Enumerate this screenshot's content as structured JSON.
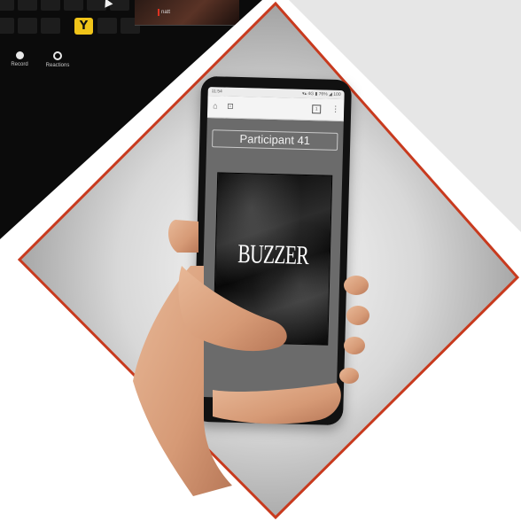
{
  "meeting": {
    "key_label": "Y",
    "video_caption": "natt",
    "tools": {
      "record": "Record",
      "reactions": "Reactions"
    }
  },
  "phone": {
    "status_time": "11:54",
    "status_right": "▾▴ 4G ▮ 76% ◢ 100",
    "browser": {
      "home_icon": "home-icon",
      "lock_icon": "lock-icon",
      "tabs_count": "1",
      "menu_icon": "menu-icon"
    },
    "participant": "Participant 41",
    "buzzer": "BUZZER"
  },
  "colors": {
    "frame_red": "#c83a1e",
    "buzzer_key_yellow": "#f0c419",
    "screen_grey": "#6b6b6b"
  }
}
